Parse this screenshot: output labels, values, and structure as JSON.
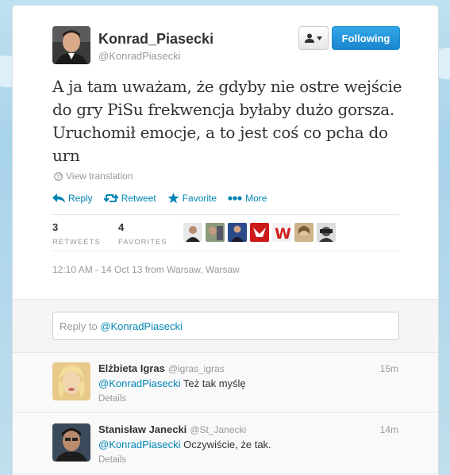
{
  "profile": {
    "name": "Konrad_Piasecki",
    "handle": "@KonradPiasecki"
  },
  "buttons": {
    "following": "Following"
  },
  "tweet": {
    "text": "A ja tam uważam, że gdyby nie ostre wejście do gry PiSu frekwencja byłaby dużo gorsza. Uruchomił emocje, a to jest coś co pcha do urn",
    "view_translation": "View translation",
    "timestamp": "12:10 AM - 14 Oct 13 from Warsaw, Warsaw"
  },
  "actions": {
    "reply": "Reply",
    "retweet": "Retweet",
    "favorite": "Favorite",
    "more": "More"
  },
  "stats": {
    "retweets_count": "3",
    "retweets_label": "RETWEETS",
    "favorites_count": "4",
    "favorites_label": "FAVORITES"
  },
  "reply_box": {
    "prefix": "Reply to ",
    "mention": "@KonradPiasecki"
  },
  "replies": [
    {
      "name": "Elżbieta Igras",
      "handle": "@igras_igras",
      "time": "15m",
      "mention": "@KonradPiasecki",
      "text": " Też tak myślę",
      "details": "Details"
    },
    {
      "name": "Stanisław Janecki",
      "handle": "@St_Janecki",
      "time": "14m",
      "mention": "@KonradPiasecki",
      "text": " Oczywiście, że tak.",
      "details": "Details"
    }
  ],
  "colors": {
    "link": "#0084b4",
    "follow_button": "#2b9ce1",
    "background": "#c0deed"
  }
}
